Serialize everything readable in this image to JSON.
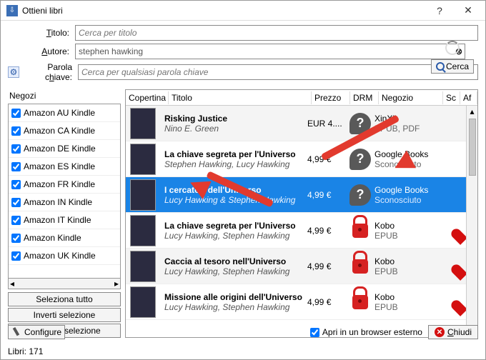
{
  "window": {
    "title": "Ottieni libri"
  },
  "form": {
    "title_label": "Titolo:",
    "title_placeholder": "Cerca per titolo",
    "author_label": "Autore:",
    "author_value": "stephen hawking",
    "keyword_label": "Parola chiave:",
    "keyword_placeholder": "Cerca per qualsiasi parola chiave",
    "search_label": "Cerca"
  },
  "stores": {
    "heading": "Negozi",
    "items": [
      "Amazon AU Kindle",
      "Amazon CA Kindle",
      "Amazon DE Kindle",
      "Amazon ES Kindle",
      "Amazon FR Kindle",
      "Amazon IN Kindle",
      "Amazon IT Kindle",
      "Amazon Kindle",
      "Amazon UK Kindle"
    ],
    "select_all": "Seleziona tutto",
    "invert": "Inverti selezione",
    "none": "Nessuna selezione"
  },
  "table": {
    "headers": {
      "cover": "Copertina",
      "title": "Titolo",
      "price": "Prezzo",
      "drm": "DRM",
      "store": "Negozio",
      "dl": "Sc",
      "af": "Af"
    },
    "rows": [
      {
        "title": "Risking Justice",
        "author": "Nino E. Green",
        "price": "EUR 4....",
        "drm": "q",
        "store": "XinXii",
        "fmt": "EPUB, PDF",
        "heart": false,
        "sel": false,
        "alt": true
      },
      {
        "title": "La chiave segreta per l'Universo",
        "author": "Stephen Hawking, Lucy Hawking",
        "price": "4,99 €",
        "drm": "q",
        "store": "Google Books",
        "fmt": "Sconosciuto",
        "heart": false,
        "sel": false,
        "alt": false
      },
      {
        "title": "I cercatori dell'Universo",
        "author": "Lucy Hawking & Stephen Hawking",
        "price": "4,99 €",
        "drm": "q",
        "store": "Google Books",
        "fmt": "Sconosciuto",
        "heart": false,
        "sel": true,
        "alt": false
      },
      {
        "title": "La chiave segreta per l'Universo",
        "author": "Lucy Hawking, Stephen Hawking",
        "price": "4,99 €",
        "drm": "lock",
        "store": "Kobo",
        "fmt": "EPUB",
        "heart": true,
        "sel": false,
        "alt": false
      },
      {
        "title": "Caccia al tesoro nell'Universo",
        "author": "Lucy Hawking, Stephen Hawking",
        "price": "4,99 €",
        "drm": "lock",
        "store": "Kobo",
        "fmt": "EPUB",
        "heart": true,
        "sel": false,
        "alt": true
      },
      {
        "title": "Missione alle origini dell'Universo",
        "author": "Lucy Hawking, Stephen Hawking",
        "price": "4,99 €",
        "drm": "lock",
        "store": "Kobo",
        "fmt": "EPUB",
        "heart": true,
        "sel": false,
        "alt": false
      }
    ]
  },
  "footer": {
    "configure": "Configure",
    "open_external": "Apri in un browser esterno",
    "close": "Chiudi",
    "status_count": "Libri:  171"
  }
}
